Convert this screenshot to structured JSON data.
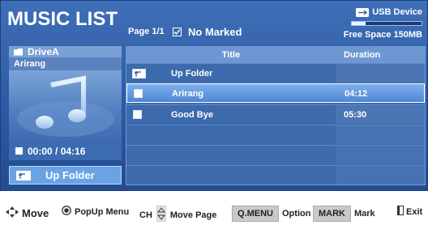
{
  "header": {
    "title": "MUSIC LIST",
    "page": "Page 1/1",
    "marked_status": "No Marked",
    "usb_label": "USB Device",
    "free_space": "Free Space 150MB",
    "usage_fraction": 0.2
  },
  "left_panel": {
    "drive": "DriveA",
    "current_song": "Arirang",
    "time": "00:00 / 04:16",
    "up_folder_button": "Up Folder"
  },
  "table": {
    "columns": [
      "Title",
      "Duration"
    ],
    "rows": [
      {
        "title": "Up Folder",
        "duration": ""
      },
      {
        "title": "Arirang",
        "duration": "04:12"
      },
      {
        "title": "Good Bye",
        "duration": "05:30"
      }
    ]
  },
  "footer": {
    "move": "Move",
    "popup_menu": "PopUp Menu",
    "ch": "CH",
    "move_page": "Move Page",
    "qmenu": "Q.MENU",
    "option": "Option",
    "mark_key": "MARK",
    "mark": "Mark",
    "exit": "Exit"
  },
  "colors": {
    "panel_bg": "#2d5aa3",
    "selection": "#6ea4ea"
  },
  "icons": [
    "folder-icon",
    "usb-icon",
    "checkbox-icon",
    "up-folder-icon",
    "stop-icon",
    "dpad-icon",
    "ok-button-icon",
    "updown-icon",
    "exit-icon",
    "music-note-icon"
  ]
}
